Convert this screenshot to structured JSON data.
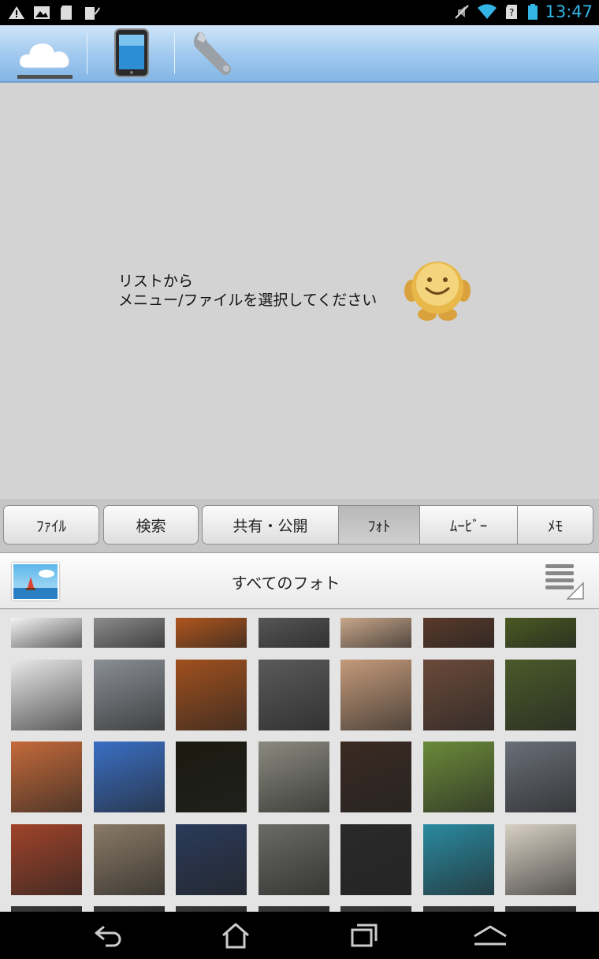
{
  "status_bar": {
    "time": "13:47",
    "left_icons": [
      "warning-icon",
      "image-icon",
      "sdcard-icon",
      "clipboard-icon"
    ],
    "right_icons": [
      "mute-icon",
      "wifi-icon",
      "sim-icon",
      "battery-icon"
    ]
  },
  "top_tabs": [
    {
      "name": "cloud-tab",
      "icon": "cloud-icon",
      "selected": true
    },
    {
      "name": "device-tab",
      "icon": "tablet-icon",
      "selected": false
    },
    {
      "name": "settings-tab",
      "icon": "wrench-icon",
      "selected": false
    }
  ],
  "empty_state": {
    "line1": "リストから",
    "line2": "メニュー/ファイルを選択してください"
  },
  "categories": {
    "file": "ﾌｧｲﾙ",
    "search": "検索",
    "share": "共有・公開",
    "photo": "ﾌｫﾄ",
    "movie": "ﾑｰﾋﾞｰ",
    "memo": "ﾒﾓ",
    "selected": "photo"
  },
  "album": {
    "title": "すべてのフォト"
  },
  "photos": [
    [
      "#e8e8e8",
      "#8a8f95",
      "#a0501e",
      "#5a5a5a",
      "#c49a7a",
      "#6b4a3a",
      "#4a5a2a"
    ],
    [
      "#c46a3a",
      "#3a6fc4",
      "#1a1a10",
      "#8a8a80",
      "#3a2a22",
      "#6a8a3a",
      "#6a6f78"
    ],
    [
      "#a0432a",
      "#8a7a66",
      "#2a3a5a",
      "#6a6a66",
      "#2a2a2a",
      "#2a8aa0",
      "#d8d0c4"
    ],
    [
      "#4a7a3a",
      "#4a6a5a",
      "#b07a4a",
      "#7aa8d8",
      "#b07a44",
      "#7a7a66",
      "#e0c23a"
    ]
  ],
  "nav": [
    "back-icon",
    "home-icon",
    "recents-icon",
    "menu-up-icon"
  ]
}
